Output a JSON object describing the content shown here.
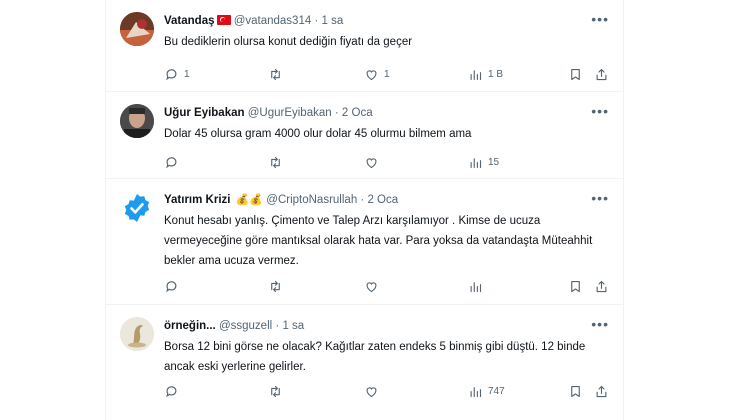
{
  "tweets": [
    {
      "name": "Vatandaş",
      "handle": "@vatandas314",
      "sep": "·",
      "time": "1 sa",
      "text": "Bu dediklerin olursa konut dediğin fiyatı da geçer",
      "replies": "1",
      "retweets": "",
      "likes": "1",
      "views": "1 B",
      "badge": "turkey-flag"
    },
    {
      "name": "Uğur Eyibakan",
      "handle": "@UgurEyibakan",
      "sep": "·",
      "time": "2 Oca",
      "text": "Dolar 45 olursa gram 4000 olur dolar 45 olurmu bilmem ama",
      "replies": "",
      "retweets": "",
      "likes": "",
      "views": "15"
    },
    {
      "name": "Yatırım Krizi",
      "handle": "@CriptoNasrullah",
      "sep": "·",
      "time": "2 Oca",
      "text": "Konut hesabı yanlış. Çimento ve Talep Arzı karşılamıyor . Kimse de ucuza vermeyeceğine göre mantıksal olarak hata var. Para yoksa da vatandaşta Müteahhit bekler ama ucuza vermez.",
      "replies": "",
      "retweets": "",
      "likes": "",
      "views": "",
      "badge_emoji": "💰💰"
    },
    {
      "name": "örneğin...",
      "handle": "@ssguzell",
      "sep": "·",
      "time": "1 sa",
      "text": "Borsa 12 bini görse ne olacak? Kağıtlar zaten endeks 5 binmiş gibi düştü. 12 binde ancak eski yerlerine gelirler.",
      "replies": "",
      "retweets": "",
      "likes": "",
      "views": "747"
    }
  ],
  "more_glyph": "•••",
  "colors": {
    "text": "#0f1419",
    "muted": "#536471",
    "border": "#eff3f4",
    "verified": "#1d9bf0"
  },
  "icons": [
    "reply-icon",
    "retweet-icon",
    "like-icon",
    "views-icon",
    "bookmark-icon",
    "share-icon",
    "more-icon"
  ]
}
